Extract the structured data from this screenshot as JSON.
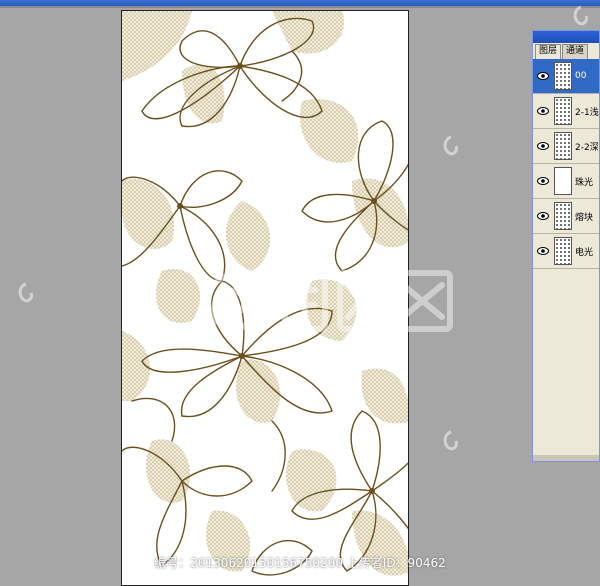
{
  "layers_panel": {
    "tabs": [
      "图层",
      "通道"
    ],
    "layers": [
      {
        "name": "00",
        "selected": true,
        "has_pattern": true
      },
      {
        "name": "2-1浅",
        "selected": false,
        "has_pattern": true
      },
      {
        "name": "2-2深",
        "selected": false,
        "has_pattern": true
      },
      {
        "name": "珠光",
        "selected": false,
        "has_pattern": false
      },
      {
        "name": "熔块",
        "selected": false,
        "has_pattern": true
      },
      {
        "name": "电光",
        "selected": false,
        "has_pattern": true
      }
    ]
  },
  "footer": {
    "text": "编号：20130620150156750200 上传者ID：90462"
  },
  "colors": {
    "workspace": "#a6a6a6",
    "line_art": "#6b4f1d",
    "dot_fill": "#d6cfae",
    "selection": "#316ac5"
  }
}
